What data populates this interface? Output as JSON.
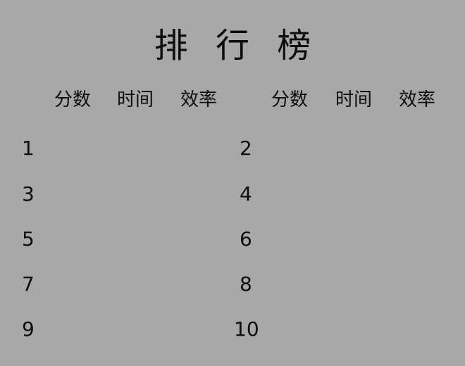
{
  "title": "排 行 榜",
  "columns": [
    "分数",
    "时间",
    "效率"
  ],
  "entries": [
    {
      "rank": "1",
      "score": "",
      "time": "",
      "efficiency": ""
    },
    {
      "rank": "2",
      "score": "",
      "time": "",
      "efficiency": ""
    },
    {
      "rank": "3",
      "score": "",
      "time": "",
      "efficiency": ""
    },
    {
      "rank": "4",
      "score": "",
      "time": "",
      "efficiency": ""
    },
    {
      "rank": "5",
      "score": "",
      "time": "",
      "efficiency": ""
    },
    {
      "rank": "6",
      "score": "",
      "time": "",
      "efficiency": ""
    },
    {
      "rank": "7",
      "score": "",
      "time": "",
      "efficiency": ""
    },
    {
      "rank": "8",
      "score": "",
      "time": "",
      "efficiency": ""
    },
    {
      "rank": "9",
      "score": "",
      "time": "",
      "efficiency": ""
    },
    {
      "rank": "10",
      "score": "",
      "time": "",
      "efficiency": ""
    }
  ],
  "colors": {
    "background": "#a8a8a8",
    "text": "#0d0d0d"
  }
}
